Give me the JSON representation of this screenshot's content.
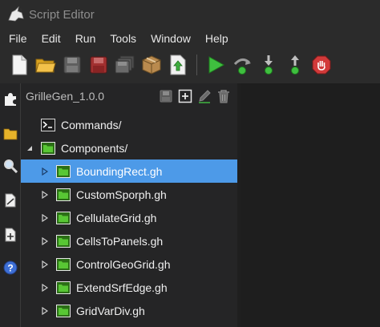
{
  "window": {
    "title": "Script Editor"
  },
  "menu": [
    "File",
    "Edit",
    "Run",
    "Tools",
    "Window",
    "Help"
  ],
  "toolbar": {
    "buttons": [
      "new-file-icon",
      "open-folder-icon",
      "save-icon",
      "save-as-icon",
      "save-all-icon",
      "package-icon",
      "export-icon"
    ],
    "run_buttons": [
      "run-icon",
      "step-over-icon",
      "step-into-icon",
      "step-out-icon",
      "stop-icon"
    ]
  },
  "sidebar": [
    "puzzle-icon",
    "explorer-folder-icon",
    "search-icon",
    "document-icon",
    "add-document-icon",
    "help-icon"
  ],
  "panel": {
    "title": "GrilleGen_1.0.0",
    "actions": [
      "save-icon",
      "add-icon",
      "edit-icon",
      "delete-icon"
    ]
  },
  "tree": [
    {
      "label": "Commands/",
      "level": 0,
      "arrow": "none",
      "icon": "terminal"
    },
    {
      "label": "Components/",
      "level": 0,
      "arrow": "expanded",
      "icon": "folder"
    },
    {
      "label": "BoundingRect.gh",
      "level": 1,
      "arrow": "collapsed",
      "icon": "grasshopper",
      "selected": true
    },
    {
      "label": "CustomSporph.gh",
      "level": 1,
      "arrow": "collapsed",
      "icon": "grasshopper"
    },
    {
      "label": "CellulateGrid.gh",
      "level": 1,
      "arrow": "collapsed",
      "icon": "grasshopper"
    },
    {
      "label": "CellsToPanels.gh",
      "level": 1,
      "arrow": "collapsed",
      "icon": "grasshopper"
    },
    {
      "label": "ControlGeoGrid.gh",
      "level": 1,
      "arrow": "collapsed",
      "icon": "grasshopper"
    },
    {
      "label": "ExtendSrfEdge.gh",
      "level": 1,
      "arrow": "collapsed",
      "icon": "grasshopper"
    },
    {
      "label": "GridVarDiv.gh",
      "level": 1,
      "arrow": "collapsed",
      "icon": "grasshopper"
    }
  ],
  "colors": {
    "selection": "#4d9ae8",
    "run_green": "#3fbf3f",
    "stop_red": "#d23a3a",
    "background": "#2b2b2b",
    "panel": "#252526"
  }
}
